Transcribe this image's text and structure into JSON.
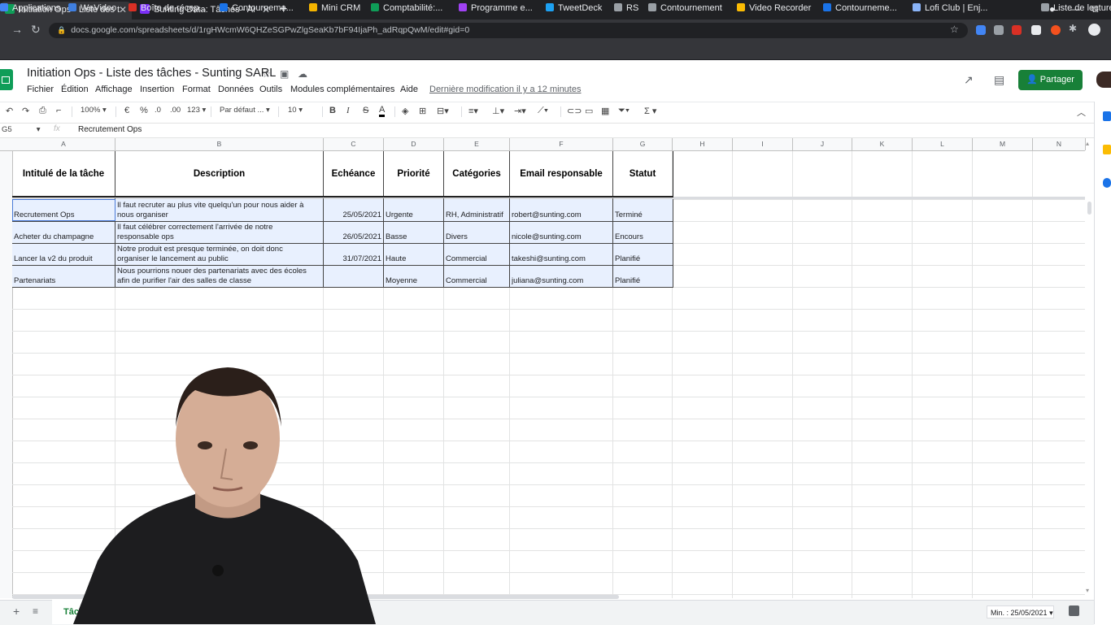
{
  "browser": {
    "tabs": [
      {
        "title": "Initiation Ops - Liste des t",
        "favicon_color": "#0f9d58"
      },
      {
        "title": "Sunting Data: Tâches - Ai",
        "favicon_color": "#7b2ff7"
      }
    ],
    "new_tab": "+",
    "url": "docs.google.com/spreadsheets/d/1rgHWcmW6QHZeSGPwZlgSeaKb7bF94IjaPh_adRqpQwM/edit#gid=0",
    "bookmarks": [
      {
        "label": "Applications",
        "icon_color": "#4285f4"
      },
      {
        "label": "WeVideo",
        "icon_color": "#3f7fe0"
      },
      {
        "label": "Boîte de récep...",
        "icon_color": "#d93025"
      },
      {
        "label": "Contourneme...",
        "icon_color": "#1a73e8"
      },
      {
        "label": "Mini CRM",
        "icon_color": "#f4b400"
      },
      {
        "label": "Comptabilité:...",
        "icon_color": "#0f9d58"
      },
      {
        "label": "Programme e...",
        "icon_color": "#a142f4"
      },
      {
        "label": "TweetDeck",
        "icon_color": "#1da1f2"
      },
      {
        "label": "RS",
        "icon_color": "#9aa0a6"
      },
      {
        "label": "Contournement",
        "icon_color": "#9aa0a6"
      },
      {
        "label": "Video Recorder",
        "icon_color": "#fbbc04"
      },
      {
        "label": "Contourneme...",
        "icon_color": "#1a73e8"
      },
      {
        "label": "Lofi Club | Enj...",
        "icon_color": "#8ab4f8"
      },
      {
        "label": "Liste de lecture",
        "icon_color": "#9aa0a6"
      }
    ]
  },
  "doc": {
    "title": "Initiation Ops - Liste des tâches - Sunting SARL",
    "menus": [
      "Fichier",
      "Édition",
      "Affichage",
      "Insertion",
      "Format",
      "Données",
      "Outils",
      "Modules complémentaires",
      "Aide"
    ],
    "last_modified": "Dernière modification il y a 12 minutes",
    "share_label": "Partager"
  },
  "toolbar": {
    "zoom": "100%",
    "currency": "€",
    "percent": "%",
    "dec_less": ".0",
    "dec_more": ".00",
    "number_format": "123",
    "font": "Par défaut ...",
    "font_size": "10",
    "bold": "B",
    "italic": "I",
    "strike": "S",
    "text_color": "A"
  },
  "formula_bar": {
    "cell_ref": "G5",
    "fx": "fx",
    "value": "Recrutement Ops"
  },
  "columns": [
    "A",
    "B",
    "C",
    "D",
    "E",
    "F",
    "G",
    "H",
    "I",
    "J",
    "K",
    "L",
    "M",
    "N"
  ],
  "headers": [
    "Intitulé de la tâche",
    "Description",
    "Echéance",
    "Priorité",
    "Catégories",
    "Email responsable",
    "Statut"
  ],
  "rows": [
    {
      "task": "Recrutement Ops",
      "desc1": "Il faut recruter au plus vite quelqu'un pour nous aider à",
      "desc2": "nous organiser",
      "due": "25/05/2021",
      "priority": "Urgente",
      "category": "RH, Administratif",
      "email": "robert@sunting.com",
      "status": "Terminé"
    },
    {
      "task": "Acheter du champagne",
      "desc1": "Il faut célébrer correctement l'arrivée de notre",
      "desc2": "responsable ops",
      "due": "26/05/2021",
      "priority": "Basse",
      "category": "Divers",
      "email": "nicole@sunting.com",
      "status": "Encours"
    },
    {
      "task": "Lancer la v2 du produit",
      "desc1": "Notre produit est presque terminée, on doit donc",
      "desc2": "organiser le lancement au public",
      "due": "31/07/2021",
      "priority": "Haute",
      "category": "Commercial",
      "email": "takeshi@sunting.com",
      "status": "Planifié"
    },
    {
      "task": "Partenariats",
      "desc1": "Nous pourrions nouer des partenariats avec des écoles",
      "desc2": "afin de purifier l'air des salles de classe",
      "due": "",
      "priority": "Moyenne",
      "category": "Commercial",
      "email": "juliana@sunting.com",
      "status": "Planifié"
    }
  ],
  "bottom": {
    "add_sheet": "+",
    "all_sheets": "≡",
    "sheet_tab": "Tâc",
    "status": "Min. : 25/05/2021"
  }
}
